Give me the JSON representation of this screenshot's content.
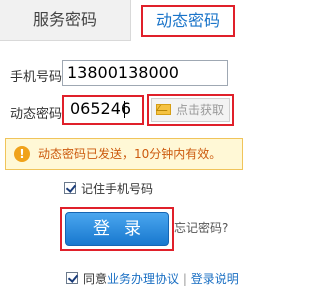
{
  "tabs": {
    "service": "服务密码",
    "dynamic": "动态密码"
  },
  "form": {
    "phone_label": "手机号码",
    "phone_value": "13800138000",
    "code_label": "动态密码",
    "code_value": "065246",
    "get_code": "点击获取"
  },
  "notice": {
    "text": "动态密码已发送，10分钟内有效。"
  },
  "remember": {
    "label": "记住手机号码",
    "checked": true
  },
  "login": {
    "label": "登录",
    "forgot": "忘记密码?"
  },
  "agreement": {
    "prefix": "同意",
    "link": "业务办理协议",
    "separator": "|",
    "help": "登录说明"
  },
  "colors": {
    "accent": "#1a74c9",
    "highlight": "#e0202a",
    "notice_bg": "#fff8d6"
  }
}
